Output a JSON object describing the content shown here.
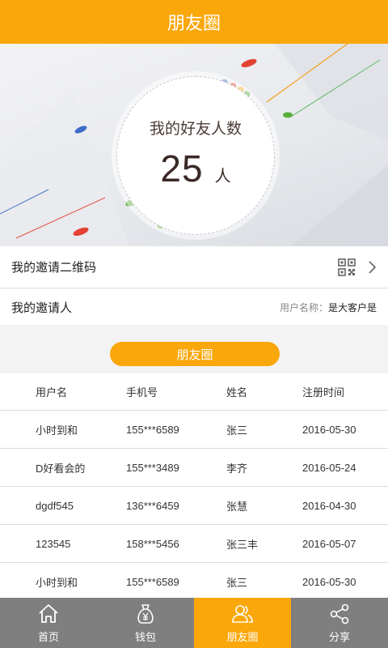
{
  "header": {
    "title": "朋友圈"
  },
  "hero": {
    "label": "我的好友人数",
    "count": "25",
    "unit": "人"
  },
  "qr_row": {
    "label": "我的邀请二维码"
  },
  "inviter_row": {
    "label": "我的邀请人",
    "key": "用户名称：",
    "value": "是大客户是"
  },
  "section_tab": {
    "label": "朋友圈"
  },
  "table": {
    "headers": [
      "用户名",
      "手机号",
      "姓名",
      "注册时间"
    ],
    "rows": [
      [
        "小时到和",
        "155***6589",
        "张三",
        "2016-05-30"
      ],
      [
        "D好看会的",
        "155***3489",
        "李齐",
        "2016-05-24"
      ],
      [
        "dgdf545",
        "136***6459",
        "张慧",
        "2016-04-30"
      ],
      [
        "123545",
        "158***5456",
        "张三丰",
        "2016-05-07"
      ],
      [
        "小时到和",
        "155***6589",
        "张三",
        "2016-05-30"
      ]
    ]
  },
  "tabbar": {
    "items": [
      {
        "label": "首页",
        "icon": "home-icon"
      },
      {
        "label": "钱包",
        "icon": "wallet-icon"
      },
      {
        "label": "朋友圈",
        "icon": "friends-icon",
        "active": true
      },
      {
        "label": "分享",
        "icon": "share-icon"
      }
    ]
  },
  "colors": {
    "accent": "#f9a70a",
    "tabbar": "#7f7f7f"
  }
}
